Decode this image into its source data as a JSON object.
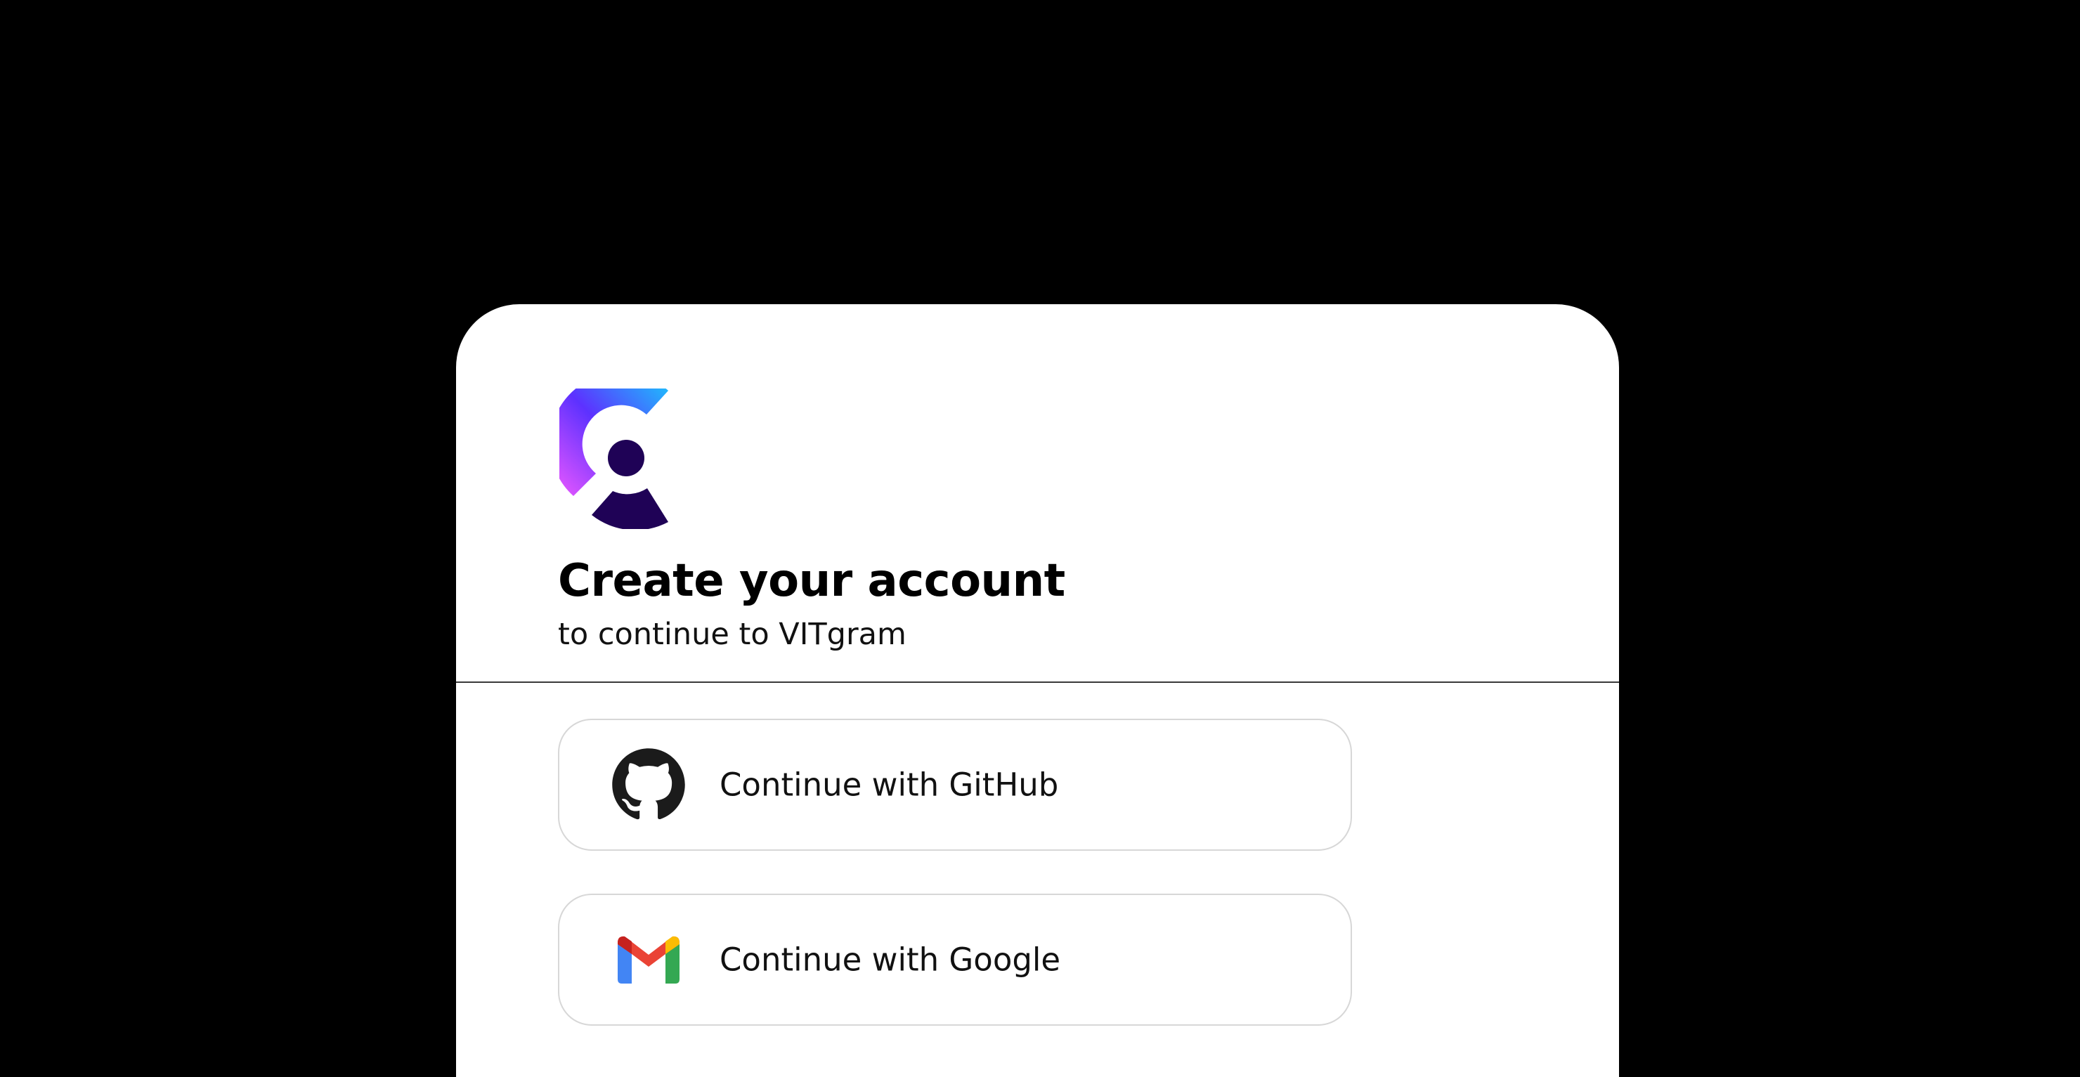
{
  "card": {
    "title": "Create your account",
    "subtitle": "to continue to VITgram"
  },
  "logo": {
    "icon": "clerk-logo-icon",
    "colors": {
      "gradient_start": "#17ccfc",
      "gradient_mid": "#5d31ff",
      "gradient_end": "#f35aff",
      "dark": "#1f0256"
    }
  },
  "social_buttons": [
    {
      "provider": "github",
      "label": "Continue with GitHub",
      "icon": "github-icon"
    },
    {
      "provider": "google",
      "label": "Continue with Google",
      "icon": "gmail-icon"
    }
  ],
  "colors": {
    "background": "#000000",
    "card": "#ffffff",
    "divider": "#3a3a3a",
    "button_border": "#d7d7d7"
  }
}
